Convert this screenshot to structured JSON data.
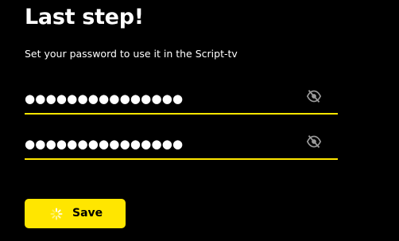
{
  "title": "Last step!",
  "subtitle": "Set your password to use it in the Script-tv",
  "password_field": {
    "value": "●●●●●●●●●●●●●●●",
    "visibility_icon": "eye-off-icon"
  },
  "confirm_field": {
    "value": "●●●●●●●●●●●●●●●",
    "visibility_icon": "eye-off-icon"
  },
  "save_button": {
    "label": "Save",
    "state": "loading",
    "icon": "spinner-icon"
  },
  "colors": {
    "background": "#000000",
    "accent": "#ffe600",
    "text": "#ffffff",
    "icon": "#9a9a9a"
  }
}
